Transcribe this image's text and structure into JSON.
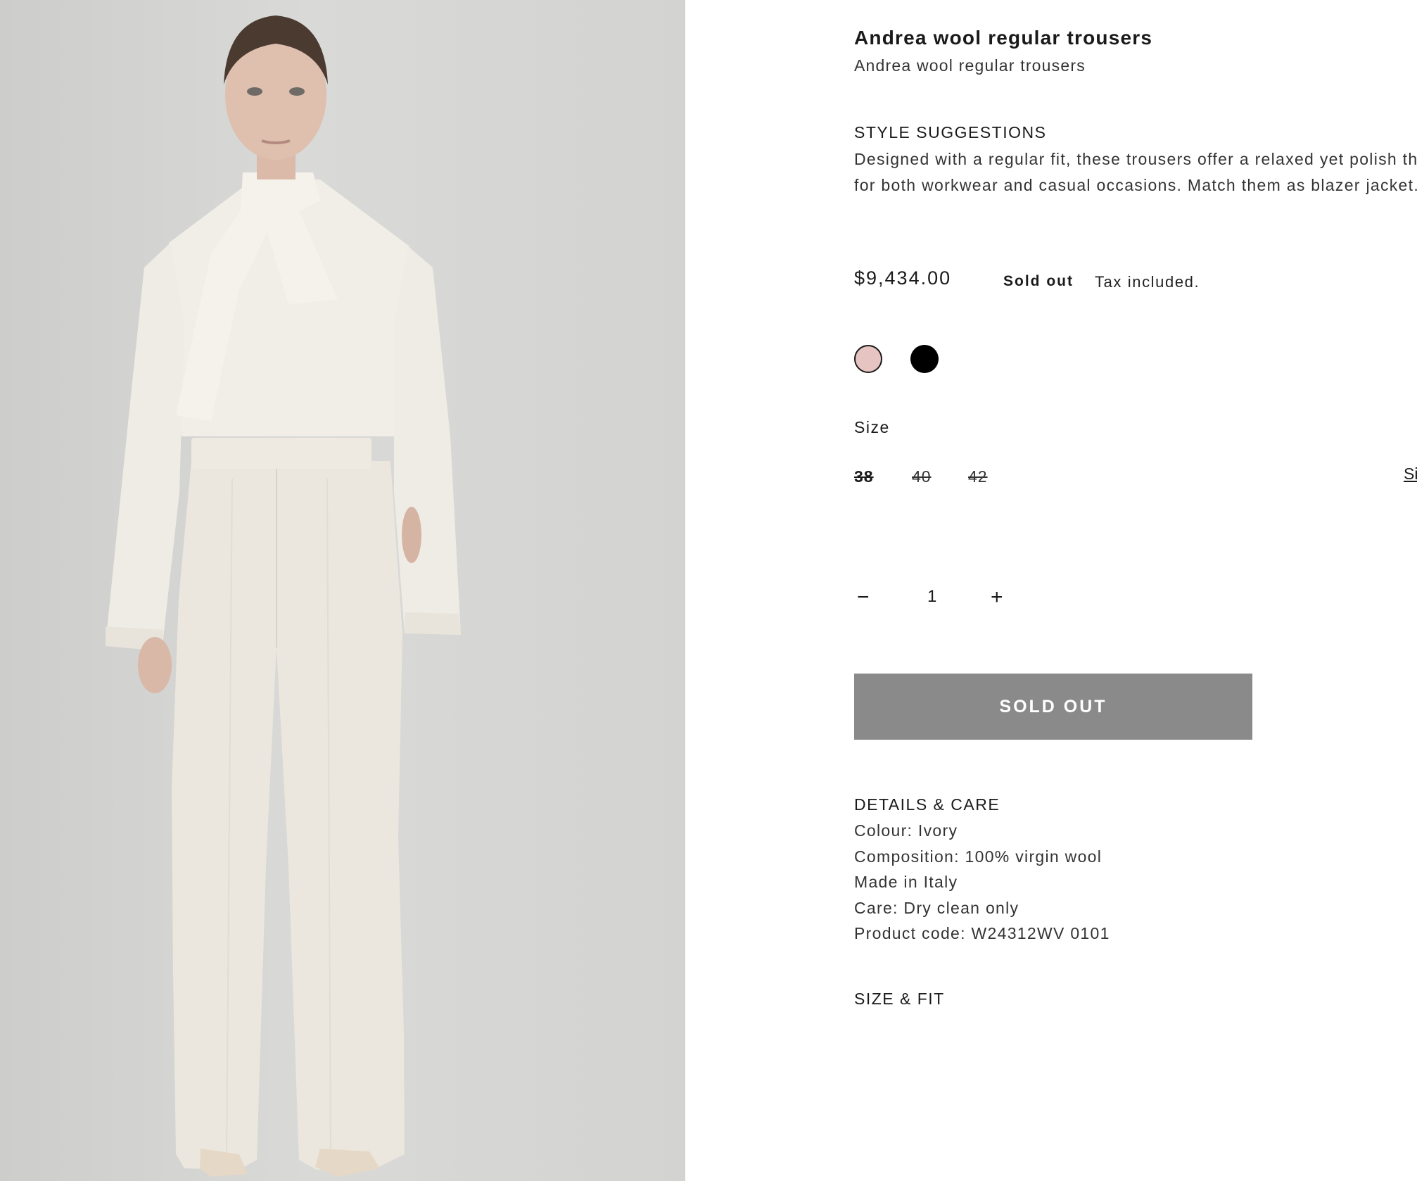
{
  "product": {
    "title": "Andrea wool regular trousers",
    "subtitle": "Andrea wool regular trousers",
    "image_alt": "Model in ivory blouse and trousers"
  },
  "style_suggestions": {
    "heading": "STYLE SUGGESTIONS",
    "text": "Designed with a regular fit, these trousers offer a relaxed yet polish them ideal for both workwear and casual occasions. Match them as blazer jacket."
  },
  "pricing": {
    "price": "$9,434.00",
    "status": "Sold out",
    "tax_note": "Tax included."
  },
  "colors": [
    {
      "name": "pink",
      "hex": "#e6c4c2"
    },
    {
      "name": "black",
      "hex": "#000000"
    }
  ],
  "size": {
    "label": "Size",
    "options": [
      "38",
      "40",
      "42"
    ],
    "selected": "38",
    "guide_link": "Si"
  },
  "quantity": {
    "minus": "−",
    "value": "1",
    "plus": "+"
  },
  "cta": {
    "label": "SOLD OUT",
    "color": "#8a8a8a"
  },
  "details": {
    "heading": "DETAILS & CARE",
    "lines": [
      "Colour: Ivory",
      "Composition: 100% virgin wool",
      "Made in Italy",
      "Care: Dry clean only",
      "Product code: W24312WV 0101"
    ]
  },
  "size_fit": {
    "heading": "SIZE & FIT"
  }
}
